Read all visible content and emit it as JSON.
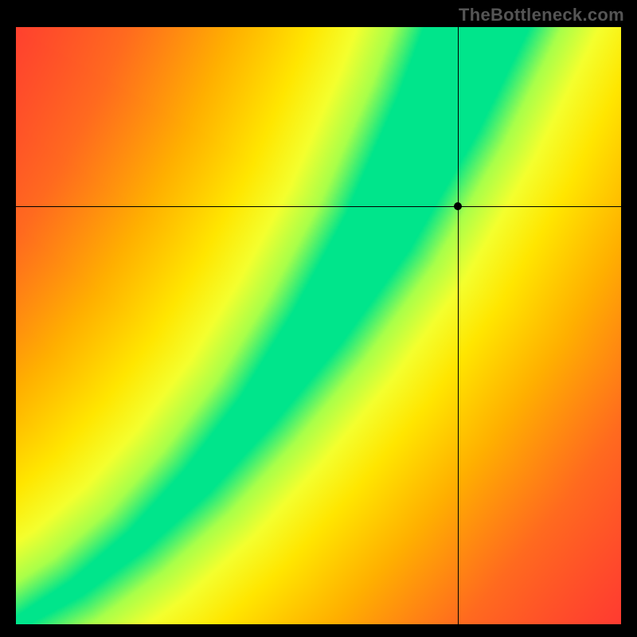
{
  "watermark": "TheBottleneck.com",
  "chart_data": {
    "type": "heatmap",
    "title": "",
    "xlabel": "",
    "ylabel": "",
    "xlim": [
      0,
      1
    ],
    "ylim": [
      0,
      1
    ],
    "crosshair": {
      "x": 0.73,
      "y": 0.7
    },
    "ridge_points": [
      {
        "x": 0.0,
        "y": 0.0
      },
      {
        "x": 0.1,
        "y": 0.06
      },
      {
        "x": 0.2,
        "y": 0.14
      },
      {
        "x": 0.3,
        "y": 0.24
      },
      {
        "x": 0.4,
        "y": 0.36
      },
      {
        "x": 0.5,
        "y": 0.5
      },
      {
        "x": 0.6,
        "y": 0.66
      },
      {
        "x": 0.65,
        "y": 0.76
      },
      {
        "x": 0.7,
        "y": 0.86
      },
      {
        "x": 0.76,
        "y": 1.0
      }
    ],
    "ridge_half_width": [
      {
        "x": 0.0,
        "w": 0.01
      },
      {
        "x": 0.2,
        "w": 0.02
      },
      {
        "x": 0.4,
        "w": 0.035
      },
      {
        "x": 0.6,
        "w": 0.06
      },
      {
        "x": 0.8,
        "w": 0.085
      },
      {
        "x": 1.0,
        "w": 0.1
      }
    ],
    "colorscale": [
      {
        "t": 0.0,
        "color": "#ff173e"
      },
      {
        "t": 0.35,
        "color": "#ff6a1f"
      },
      {
        "t": 0.55,
        "color": "#ffb000"
      },
      {
        "t": 0.72,
        "color": "#ffe600"
      },
      {
        "t": 0.83,
        "color": "#f4ff2e"
      },
      {
        "t": 0.92,
        "color": "#a8ff4a"
      },
      {
        "t": 1.0,
        "color": "#00e58b"
      }
    ],
    "description": "2D heatmap with a green optimal ridge curving from bottom-left to upper-center; colors fade through yellow/orange to red away from the ridge. Black crosshair marks a point near the upper-right quadrant."
  }
}
